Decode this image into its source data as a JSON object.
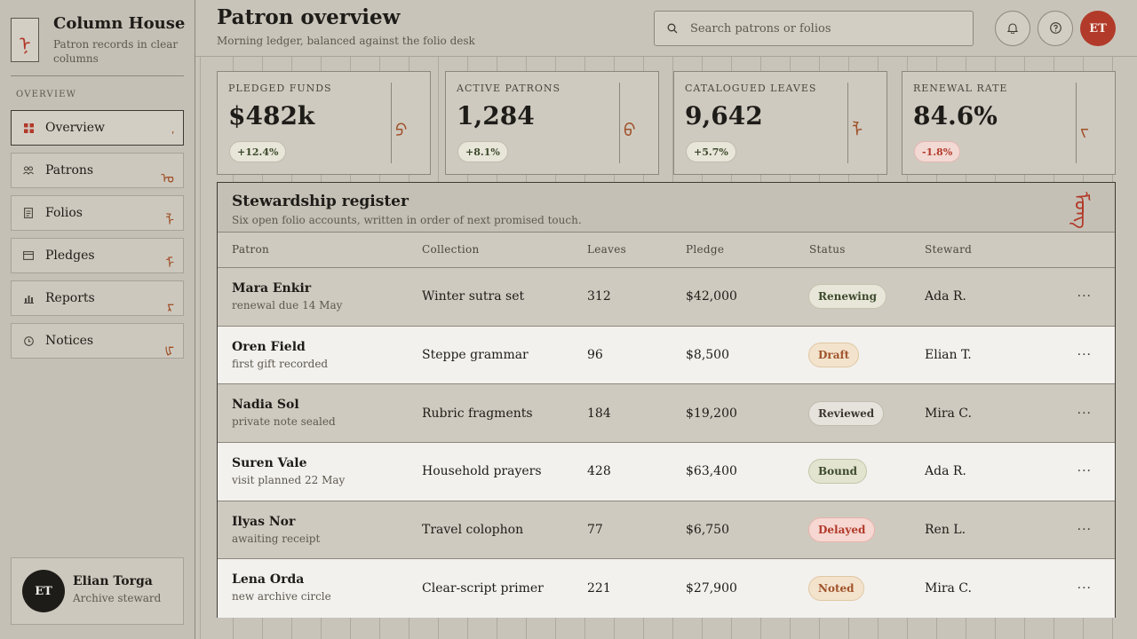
{
  "brand": {
    "title": "Column House",
    "subtitle": "Patron records in clear columns",
    "mark_glyph": "ᠨ"
  },
  "sidebar": {
    "section_label": "OVERVIEW",
    "items": [
      {
        "label": "Overview",
        "icon": "grid-icon",
        "glyph": "ᡃ",
        "active": true
      },
      {
        "label": "Patrons",
        "icon": "people-icon",
        "glyph": "ᠣ",
        "active": false
      },
      {
        "label": "Folios",
        "icon": "document-icon",
        "glyph": "ᠯ",
        "active": false
      },
      {
        "label": "Pledges",
        "icon": "card-icon",
        "glyph": "ᠮ",
        "active": false
      },
      {
        "label": "Reports",
        "icon": "bar-chart-icon",
        "glyph": "ᠷ",
        "active": false
      },
      {
        "label": "Notices",
        "icon": "clock-icon",
        "glyph": "ᡁ",
        "active": false
      }
    ],
    "user": {
      "initials": "ET",
      "name": "Elian Torga",
      "role": "Archive steward"
    }
  },
  "header": {
    "title": "Patron overview",
    "subtitle": "Morning ledger, balanced against the folio desk",
    "search_placeholder": "Search patrons or folios",
    "avatar_initials": "ET"
  },
  "stats": [
    {
      "label": "PLEDGED FUNDS",
      "value": "$482k",
      "delta": "+12.4%",
      "trend": "up",
      "glyph": "ᠫ"
    },
    {
      "label": "ACTIVE PATRONS",
      "value": "1,284",
      "delta": "+8.1%",
      "trend": "up",
      "glyph": "ᠪ"
    },
    {
      "label": "CATALOGUED LEAVES",
      "value": "9,642",
      "delta": "+5.7%",
      "trend": "up",
      "glyph": "ᠯ"
    },
    {
      "label": "RENEWAL RATE",
      "value": "84.6%",
      "delta": "-1.8%",
      "trend": "down",
      "glyph": "ᠵ"
    }
  ],
  "register": {
    "title": "Stewardship register",
    "subtitle": "Six open folio accounts, written in order of next promised touch.",
    "glyph": "ᠮᠣᠩ",
    "columns": [
      "Patron",
      "Collection",
      "Leaves",
      "Pledge",
      "Status",
      "Steward"
    ],
    "rows": [
      {
        "name": "Mara Enkir",
        "note": "renewal due 14 May",
        "collection": "Winter sutra set",
        "leaves": "312",
        "pledge": "$42,000",
        "status": "Renewing",
        "status_key": "renewing",
        "steward": "Ada R."
      },
      {
        "name": "Oren Field",
        "note": "first gift recorded",
        "collection": "Steppe grammar",
        "leaves": "96",
        "pledge": "$8,500",
        "status": "Draft",
        "status_key": "draft",
        "steward": "Elian T."
      },
      {
        "name": "Nadia Sol",
        "note": "private note sealed",
        "collection": "Rubric fragments",
        "leaves": "184",
        "pledge": "$19,200",
        "status": "Reviewed",
        "status_key": "reviewed",
        "steward": "Mira C."
      },
      {
        "name": "Suren Vale",
        "note": "visit planned 22 May",
        "collection": "Household prayers",
        "leaves": "428",
        "pledge": "$63,400",
        "status": "Bound",
        "status_key": "bound",
        "steward": "Ada R."
      },
      {
        "name": "Ilyas Nor",
        "note": "awaiting receipt",
        "collection": "Travel colophon",
        "leaves": "77",
        "pledge": "$6,750",
        "status": "Delayed",
        "status_key": "delayed",
        "steward": "Ren L."
      },
      {
        "name": "Lena Orda",
        "note": "new archive circle",
        "collection": "Clear-script primer",
        "leaves": "221",
        "pledge": "$27,900",
        "status": "Noted",
        "status_key": "noted",
        "steward": "Mira C."
      }
    ],
    "row_menu": "···"
  },
  "colors": {
    "accent_red": "#b23a2a",
    "accent_ochre": "#a0532b",
    "ink": "#1e1c18",
    "paper": "#c9c4ba"
  }
}
